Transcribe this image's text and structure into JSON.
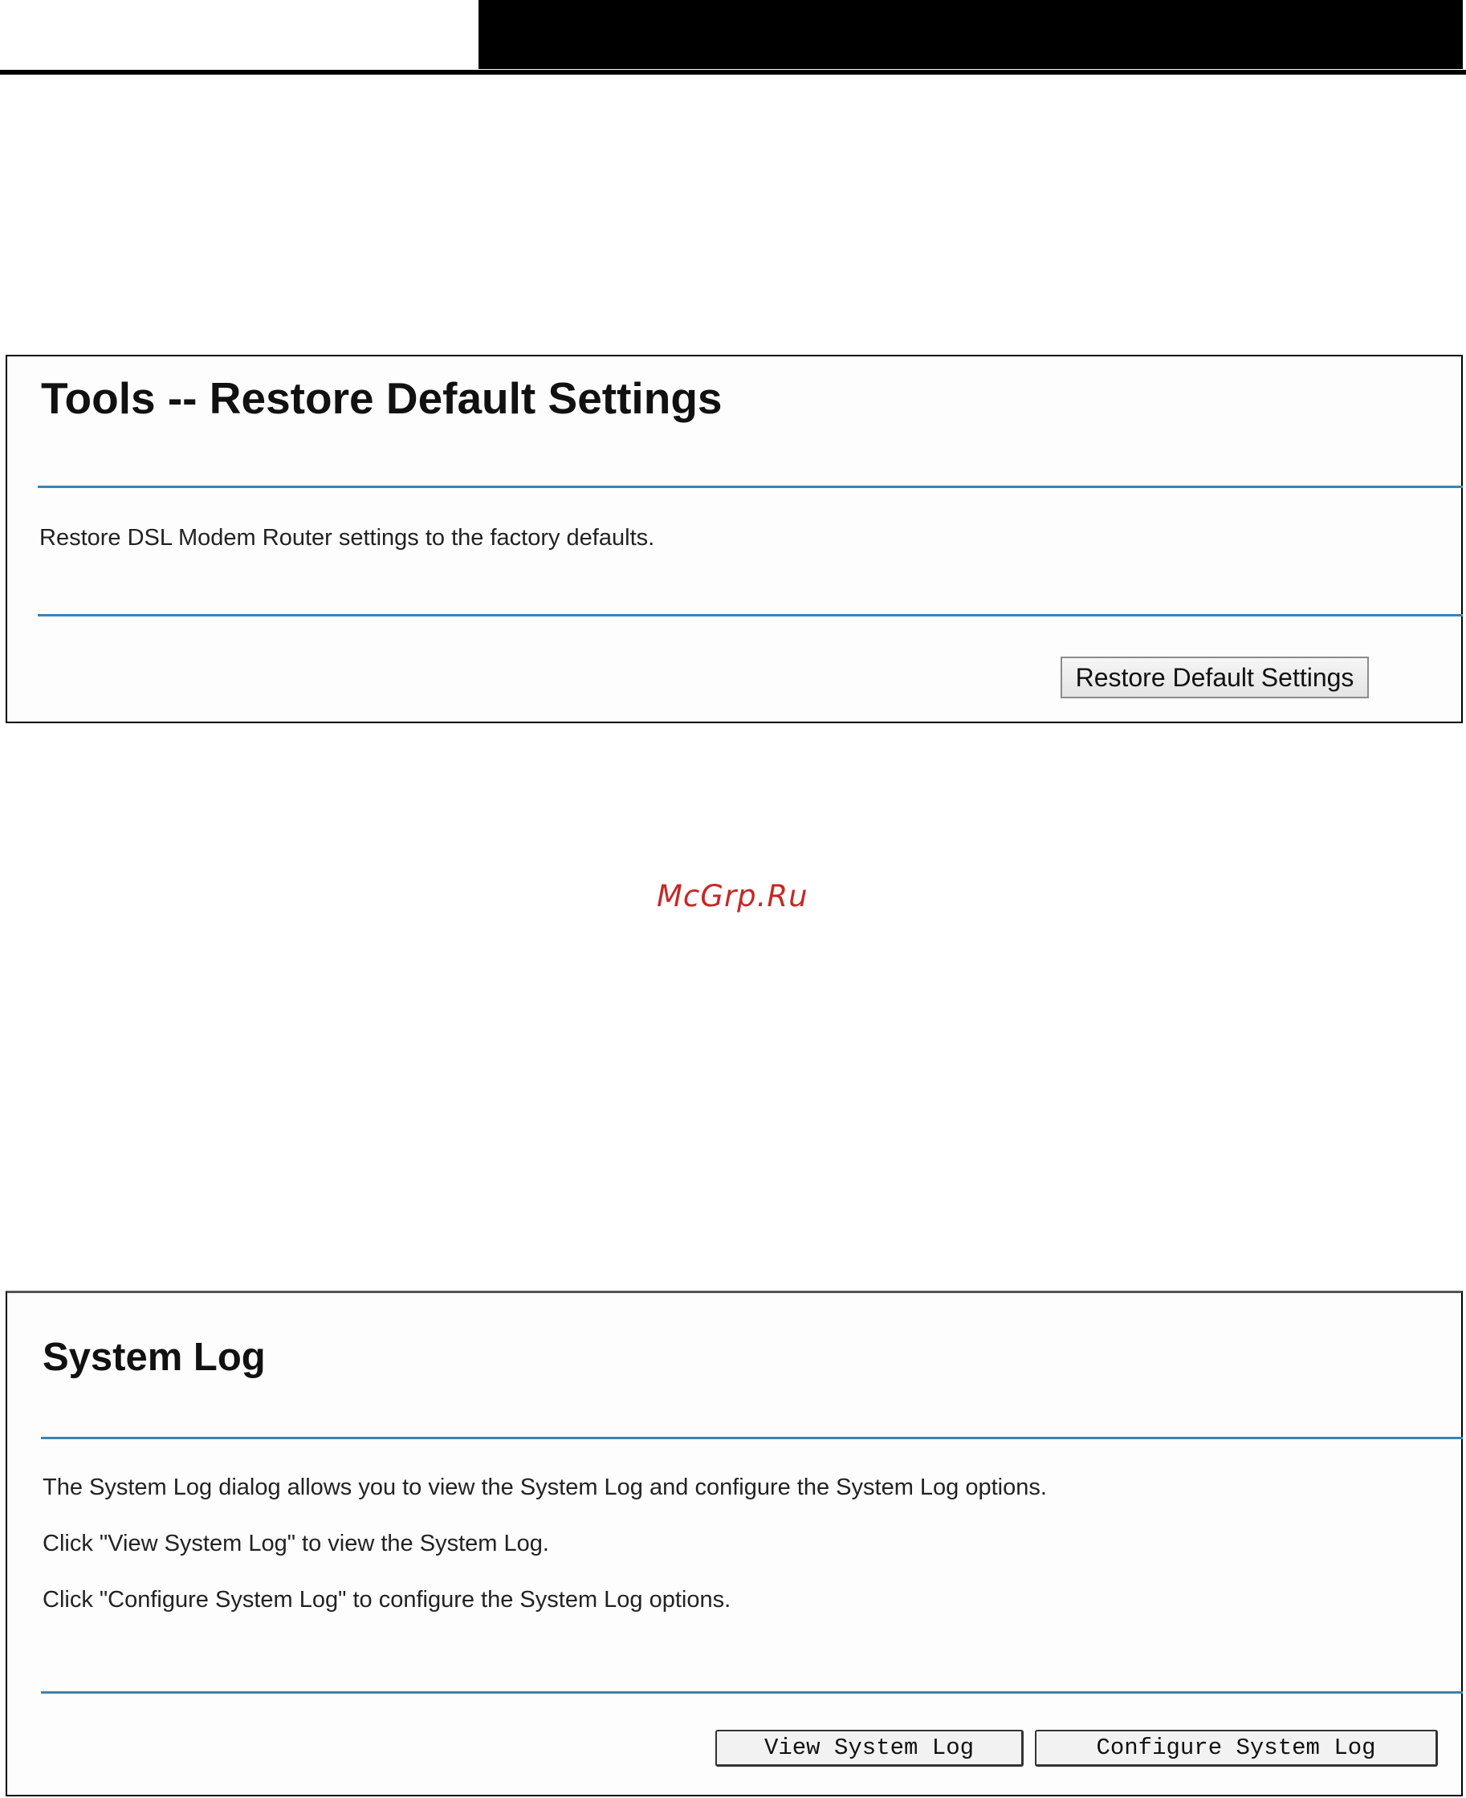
{
  "restore_panel": {
    "title": "Tools -- Restore Default Settings",
    "description": "Restore DSL Modem Router settings to the factory defaults.",
    "button_label": "Restore Default Settings"
  },
  "watermark": "McGrp.Ru",
  "system_log_panel": {
    "title": "System Log",
    "lines": [
      "The System Log dialog allows you to view the System Log and configure the System Log options.",
      "Click \"View System Log\" to view the System Log.",
      "Click \"Configure System Log\" to configure the System Log options."
    ],
    "view_button_label": "View System Log",
    "configure_button_label": "Configure System Log"
  },
  "colors": {
    "divider": "#3d82b3",
    "watermark": "#c62828",
    "header_bar": "#000000"
  }
}
